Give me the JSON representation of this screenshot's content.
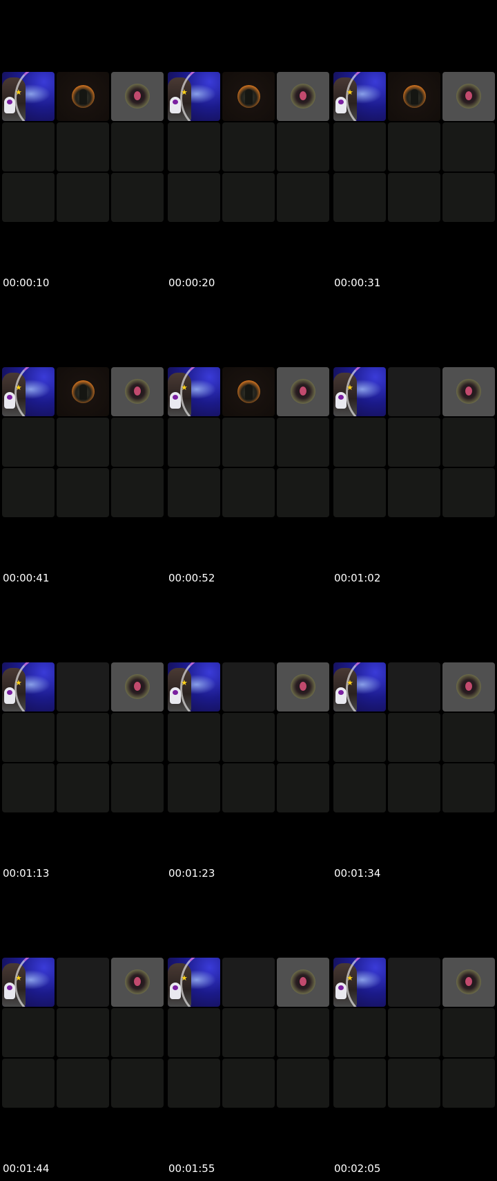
{
  "frames": [
    {
      "timestamp": "00:00:10"
    },
    {
      "timestamp": "00:00:20"
    },
    {
      "timestamp": "00:00:31"
    },
    {
      "timestamp": "00:00:41"
    },
    {
      "timestamp": "00:00:52"
    },
    {
      "timestamp": "00:01:02"
    },
    {
      "timestamp": "00:01:13"
    },
    {
      "timestamp": "00:01:23"
    },
    {
      "timestamp": "00:01:34"
    },
    {
      "timestamp": "00:01:44"
    },
    {
      "timestamp": "00:01:55"
    },
    {
      "timestamp": "00:02:05"
    }
  ],
  "tile_icons": [
    "galaxy-avatar-video",
    "ember-avatar",
    "grey-avatar"
  ],
  "colors": {
    "background": "#000000",
    "empty_tile": "#181917",
    "grey_tile": "#505050",
    "text": "#ffffff"
  }
}
